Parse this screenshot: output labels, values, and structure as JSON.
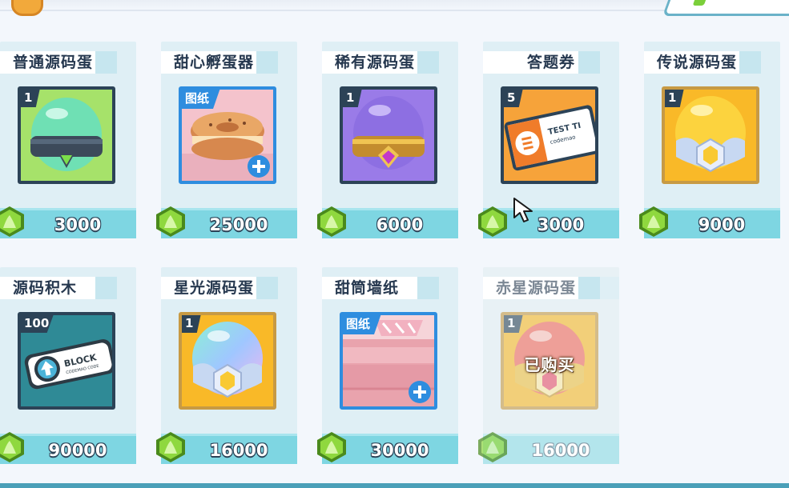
{
  "colors": {
    "gem": "#7bcf3a",
    "price_bar": "#7ed6e2",
    "blueprint": "#2e8ddf",
    "dark": "#2c4357"
  },
  "shop_items": [
    {
      "name": "普通源码蛋",
      "qty": "1",
      "price": "3000",
      "art": "green-egg-icon"
    },
    {
      "name": "甜心孵蛋器",
      "badge": "图纸",
      "price": "25000",
      "art": "cookie-incubator-icon"
    },
    {
      "name": "稀有源码蛋",
      "qty": "1",
      "price": "6000",
      "art": "purple-egg-icon"
    },
    {
      "name": "答题券",
      "qty": "5",
      "price": "3000",
      "art": "quiz-ticket-icon",
      "ticket_text": "TEST TI",
      "ticket_sub": "codemao"
    },
    {
      "name": "传说源码蛋",
      "qty": "1",
      "price": "9000",
      "art": "gold-egg-icon"
    },
    {
      "name": "源码积木",
      "qty": "100",
      "price": "90000",
      "art": "code-block-icon",
      "block_text": "BLOCK",
      "block_sub": "CODEMAO CODE"
    },
    {
      "name": "星光源码蛋",
      "qty": "1",
      "price": "16000",
      "art": "rainbow-egg-icon"
    },
    {
      "name": "甜筒墙纸",
      "badge": "图纸",
      "price": "30000",
      "art": "icecream-wallpaper-icon"
    },
    {
      "name": "赤星源码蛋",
      "qty": "1",
      "price": "16000",
      "art": "red-egg-icon",
      "status": "已购买"
    }
  ]
}
